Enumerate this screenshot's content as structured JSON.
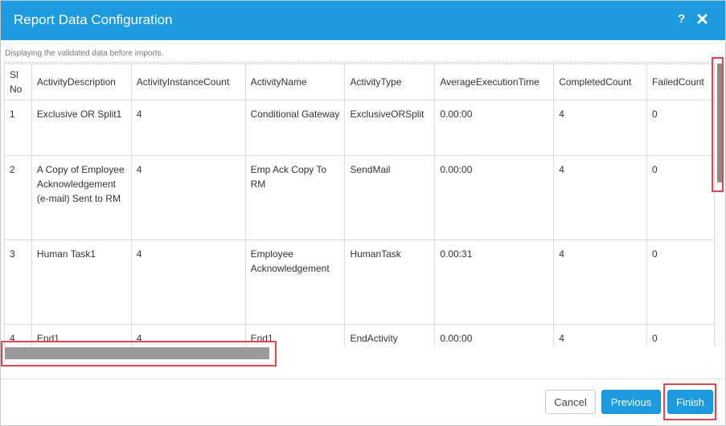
{
  "dialog": {
    "title": "Report Data Configuration",
    "help_label": "?",
    "subtitle": "Displaying the validated data before imports."
  },
  "table": {
    "headers": [
      "Sl No",
      "ActivityDescription",
      "ActivityInstanceCount",
      "ActivityName",
      "ActivityType",
      "AverageExecutionTime",
      "CompletedCount",
      "FailedCount"
    ],
    "rows": [
      [
        "1",
        "Exclusive OR Split1",
        "4",
        "Conditional Gateway",
        "ExclusiveORSplit",
        "0.00:00",
        "4",
        "0"
      ],
      [
        "2",
        "A Copy of Employee Acknowledgement (e-mail) Sent to RM",
        "4",
        "Emp Ack Copy To RM",
        "SendMail",
        "0.00:00",
        "4",
        "0"
      ],
      [
        "3",
        "Human Task1",
        "4",
        "Employee Acknowledgement",
        "HumanTask",
        "0.00:31",
        "4",
        "0"
      ],
      [
        "4",
        "End1",
        "4",
        "End1",
        "EndActivity",
        "0.00:00",
        "4",
        "0"
      ]
    ]
  },
  "buttons": {
    "cancel": "Cancel",
    "previous": "Previous",
    "finish": "Finish"
  },
  "colors": {
    "accent": "#1c9be0",
    "highlight": "#e8444b"
  },
  "icons": {
    "close": "close-icon",
    "help": "help-icon"
  }
}
